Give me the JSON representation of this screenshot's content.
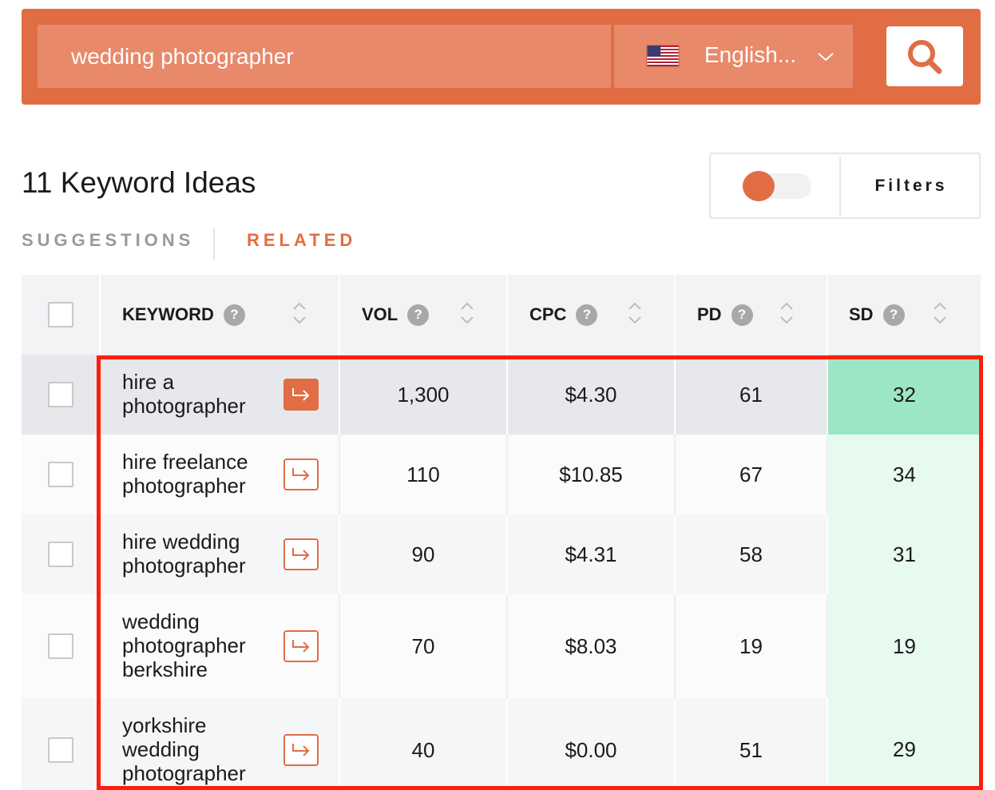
{
  "search": {
    "query": "wedding photographer",
    "language": "English...",
    "colors": {
      "brand": "#e16d45",
      "input_bg": "#e8896a"
    }
  },
  "heading": {
    "title": "11 Keyword Ideas",
    "filters_label": "Filters"
  },
  "tabs": {
    "suggestions": "SUGGESTIONS",
    "related": "RELATED",
    "active": "related"
  },
  "table": {
    "headers": {
      "keyword": "KEYWORD",
      "vol": "VOL",
      "cpc": "CPC",
      "pd": "PD",
      "sd": "SD",
      "help": "?"
    },
    "rows": [
      {
        "keyword": "hire a photographer",
        "vol": "1,300",
        "cpc": "$4.30",
        "pd": "61",
        "sd": "32"
      },
      {
        "keyword": "hire freelance photographer",
        "vol": "110",
        "cpc": "$10.85",
        "pd": "67",
        "sd": "34"
      },
      {
        "keyword": "hire wedding photographer",
        "vol": "90",
        "cpc": "$4.31",
        "pd": "58",
        "sd": "31"
      },
      {
        "keyword": "wedding photographer berkshire",
        "vol": "70",
        "cpc": "$8.03",
        "pd": "19",
        "sd": "19"
      },
      {
        "keyword": "yorkshire wedding photographer",
        "vol": "40",
        "cpc": "$0.00",
        "pd": "51",
        "sd": "29"
      }
    ]
  },
  "colors": {
    "sd_highlight": "#9de6c4",
    "sd_light": "#e6faf0",
    "row_hover": "#e6e8eb",
    "row_odd": "#f7f8f9",
    "row_even": "#fbfbfc",
    "annotation_border": "#ff1d0d"
  }
}
